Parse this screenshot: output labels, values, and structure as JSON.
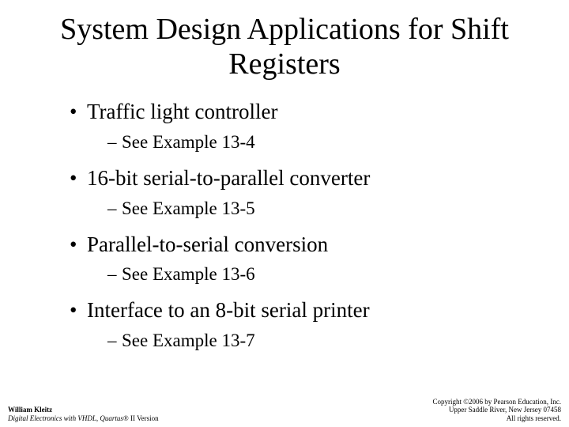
{
  "title": "System Design Applications for Shift Registers",
  "bullets": [
    {
      "text": "Traffic light controller",
      "sub": "See Example 13-4"
    },
    {
      "text": "16-bit serial-to-parallel converter",
      "sub": "See Example 13-5"
    },
    {
      "text": "Parallel-to-serial conversion",
      "sub": "See Example 13-6"
    },
    {
      "text": "Interface to an 8-bit serial printer",
      "sub": "See Example 13-7"
    }
  ],
  "footer": {
    "left": {
      "author": "William Kleitz",
      "book_ital": "Digital Electronics with VHDL, Quartus",
      "book_roman": "® II Version"
    },
    "right": {
      "line1": "Copyright ©2006 by Pearson Education, Inc.",
      "line2": "Upper Saddle River, New Jersey 07458",
      "line3": "All rights reserved."
    }
  }
}
